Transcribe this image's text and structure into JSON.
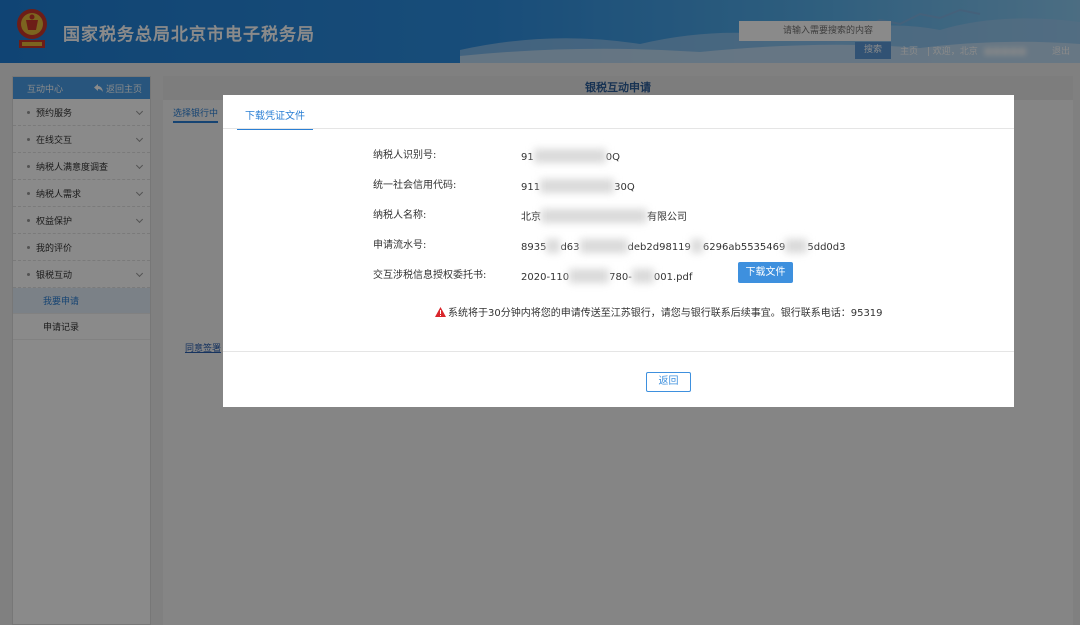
{
  "header": {
    "site_title": "国家税务总局北京市电子税务局",
    "search_placeholder": "请输入需要搜索的内容",
    "search_label": "搜索",
    "home_link": "主页",
    "welcome_text": "|  欢迎，北京",
    "logout_label": "退出"
  },
  "sidebar": {
    "title": "互动中心",
    "back_label": "返回主页",
    "items": [
      {
        "label": "预约服务"
      },
      {
        "label": "在线交互"
      },
      {
        "label": "纳税人满意度调查"
      },
      {
        "label": "纳税人需求"
      },
      {
        "label": "权益保护"
      },
      {
        "label": "我的评价"
      },
      {
        "label": "银税互动"
      }
    ],
    "sub_items": [
      {
        "label": "我要申请",
        "active": true
      },
      {
        "label": "申请记录",
        "active": false
      }
    ]
  },
  "main": {
    "title": "银税互动申请",
    "tab": "选择银行中",
    "link": "同意签署"
  },
  "modal": {
    "tab_label": "下载凭证文件",
    "rows": [
      {
        "label": "纳税人识别号:",
        "value_start": "91",
        "value_end": "0Q"
      },
      {
        "label": "统一社会信用代码:",
        "value_start": "911",
        "value_end": "30Q"
      },
      {
        "label": "纳税人名称:",
        "value_start": "北京",
        "value_end": "有限公司"
      },
      {
        "label": "申请流水号:",
        "value_start": "8935",
        "value_mid1": "d63",
        "value_mid2": "deb2d98119",
        "value_mid3": "6296ab5535469",
        "value_end": "5dd0d3"
      },
      {
        "label": "交互涉税信息授权委托书:",
        "value_start": "2020-110",
        "value_mid1": "780-",
        "value_end": "001.pdf"
      }
    ],
    "download_label": "下载文件",
    "warning_text": "系统将于30分钟内将您的申请传送至江苏银行，请您与银行联系后续事宜。银行联系电话：95319",
    "back_label": "返回"
  },
  "colors": {
    "accent": "#3e90de",
    "header_start": "#1f7fd6",
    "warning_icon": "#d9262c"
  }
}
